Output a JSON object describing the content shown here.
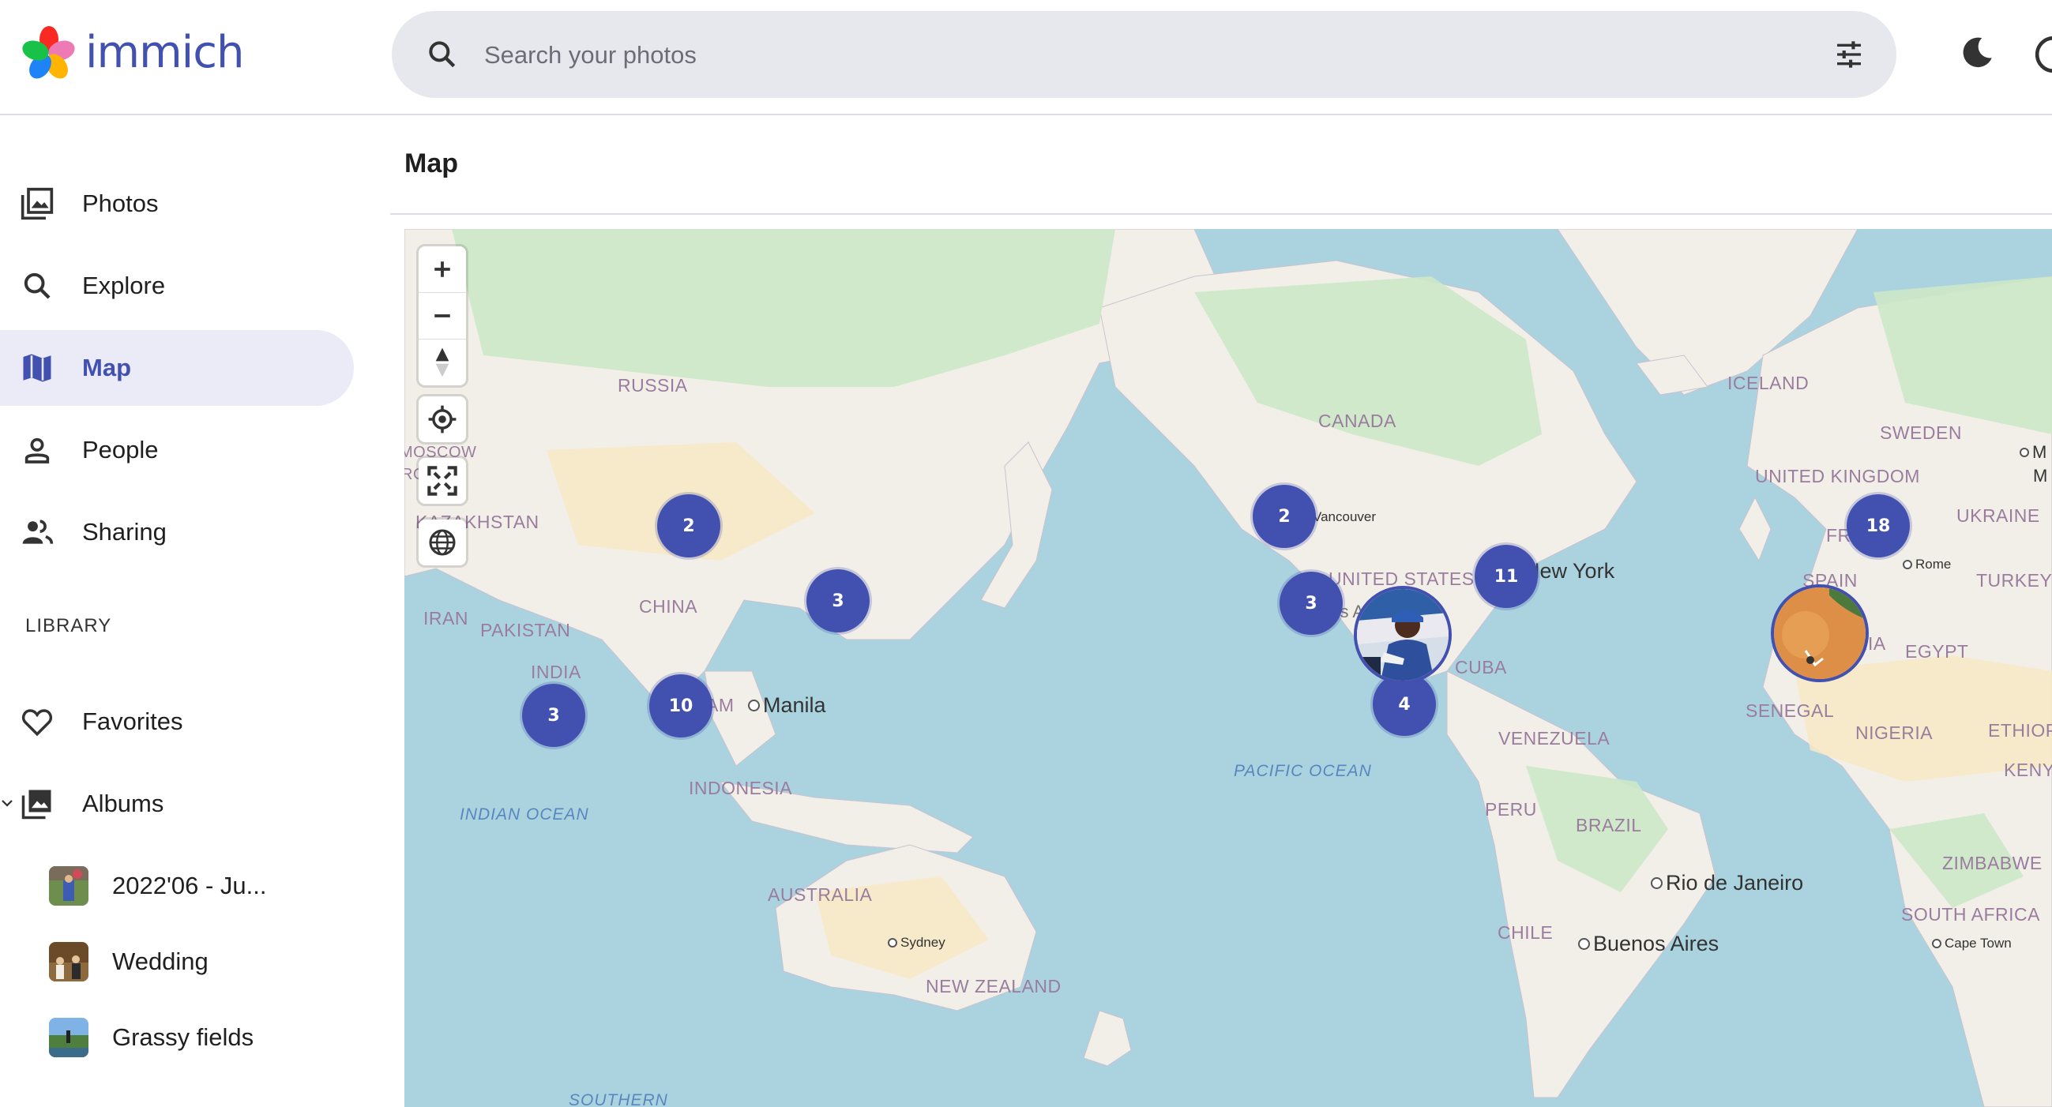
{
  "app": {
    "name": "immich"
  },
  "search": {
    "placeholder": "Search your photos"
  },
  "header_icons": [
    "search-icon",
    "filter-icon",
    "theme-toggle-icon",
    "help-icon"
  ],
  "sidebar": {
    "items": [
      {
        "label": "Photos",
        "icon": "photos-icon",
        "active": false
      },
      {
        "label": "Explore",
        "icon": "search-icon",
        "active": false
      },
      {
        "label": "Map",
        "icon": "map-icon",
        "active": true
      },
      {
        "label": "People",
        "icon": "person-icon",
        "active": false
      },
      {
        "label": "Sharing",
        "icon": "sharing-icon",
        "active": false
      }
    ],
    "library_label": "LIBRARY",
    "library_items": [
      {
        "label": "Favorites",
        "icon": "heart-icon"
      },
      {
        "label": "Albums",
        "icon": "albums-icon"
      }
    ],
    "albums": [
      {
        "label": "2022'06 - Ju..."
      },
      {
        "label": "Wedding"
      },
      {
        "label": "Grassy fields"
      }
    ]
  },
  "main": {
    "title": "Map"
  },
  "map": {
    "controls": [
      "zoom-in",
      "zoom-out",
      "compass",
      "locate",
      "fullscreen",
      "globe"
    ],
    "clusters": [
      {
        "id": "china-north",
        "count": "2"
      },
      {
        "id": "japan",
        "count": "3"
      },
      {
        "id": "india",
        "count": "3"
      },
      {
        "id": "vietnam",
        "count": "10"
      },
      {
        "id": "vancouver",
        "count": "2"
      },
      {
        "id": "los-angeles",
        "count": "3"
      },
      {
        "id": "new-york",
        "count": "11"
      },
      {
        "id": "mexico",
        "count": "4"
      },
      {
        "id": "france",
        "count": "18"
      }
    ],
    "countries": [
      "RUSSIA",
      "KAZAKHSTAN",
      "CHINA",
      "IRAN",
      "PAKISTAN",
      "INDIA",
      "INDONESIA",
      "AUSTRALIA",
      "NEW ZEALAND",
      "CANADA",
      "UNITED STATES",
      "CUBA",
      "VENEZUELA",
      "PERU",
      "BRAZIL",
      "CHILE",
      "ICELAND",
      "SWEDEN",
      "UNITED KINGDOM",
      "UKRAINE",
      "TURKEY",
      "EGYPT",
      "SENEGAL",
      "NIGERIA",
      "ETHIOP",
      "KENYA",
      "ZIMBABWE",
      "SOUTH AFRICA",
      "ERIA",
      "SPAIN",
      "FR",
      "AM",
      "MOSCOW",
      "ROS"
    ],
    "oceans": [
      "INDIAN OCEAN",
      "PACIFIC OCEAN",
      "SOUTHERN"
    ],
    "cities": [
      "Manila",
      "New York",
      "Rio de Janeiro",
      "Buenos Aires",
      "Sydney",
      "Rome",
      "Cape Town",
      "Vancouver",
      "Los A",
      "M",
      "M"
    ]
  },
  "colors": {
    "accent": "#4250af",
    "active_bg": "#eaebf7",
    "search_bg": "#e6e8ed",
    "water": "#aad3df",
    "land": "#f2efe9",
    "forest": "#c8e6c9"
  }
}
